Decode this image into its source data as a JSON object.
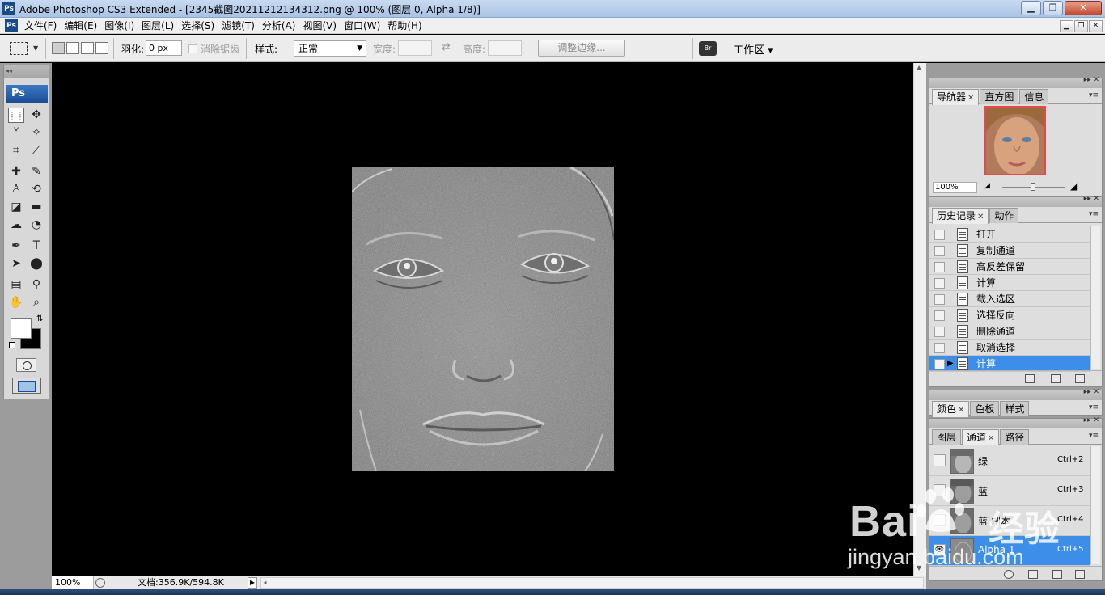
{
  "window": {
    "title": "Adobe Photoshop CS3 Extended - [2345截图20211212134312.png @ 100% (图层 0, Alpha 1/8)]",
    "app_badge": "Ps"
  },
  "menu": [
    "文件(F)",
    "编辑(E)",
    "图像(I)",
    "图层(L)",
    "选择(S)",
    "滤镜(T)",
    "分析(A)",
    "视图(V)",
    "窗口(W)",
    "帮助(H)"
  ],
  "options": {
    "feather_label": "羽化:",
    "feather_value": "0 px",
    "antialias_label": "消除锯齿",
    "style_label": "样式:",
    "style_value": "正常",
    "width_label": "宽度:",
    "height_label": "高度:",
    "refine_button": "调整边缘...",
    "workspace": "工作区"
  },
  "toolbox": {
    "badge": "Ps"
  },
  "status": {
    "zoom": "100%",
    "doc_size": "文档:356.9K/594.8K"
  },
  "navigator": {
    "tabs": [
      "导航器",
      "直方图",
      "信息"
    ],
    "zoom": "100%"
  },
  "history": {
    "tabs": [
      "历史记录",
      "动作"
    ],
    "items": [
      "打开",
      "复制通道",
      "高反差保留",
      "计算",
      "载入选区",
      "选择反向",
      "删除通道",
      "取消选择",
      "计算"
    ],
    "selected_index": 8
  },
  "color_panel": {
    "tabs": [
      "颜色",
      "色板",
      "样式"
    ]
  },
  "channels": {
    "tabs": [
      "图层",
      "通道",
      "路径"
    ],
    "items": [
      {
        "name": "绿",
        "shortcut": "Ctrl+2"
      },
      {
        "name": "蓝",
        "shortcut": "Ctrl+3"
      },
      {
        "name": "蓝 副本",
        "shortcut": "Ctrl+4"
      },
      {
        "name": "Alpha 1",
        "shortcut": "Ctrl+5"
      }
    ],
    "selected_index": 3
  },
  "watermark": {
    "brand": "Bai",
    "cn": "经验",
    "url": "jingyan.baidu.com"
  },
  "colors": {
    "selection": "#3d8ee8",
    "canvas": "#000000",
    "foreground": "#ffffff",
    "background": "#000000"
  }
}
